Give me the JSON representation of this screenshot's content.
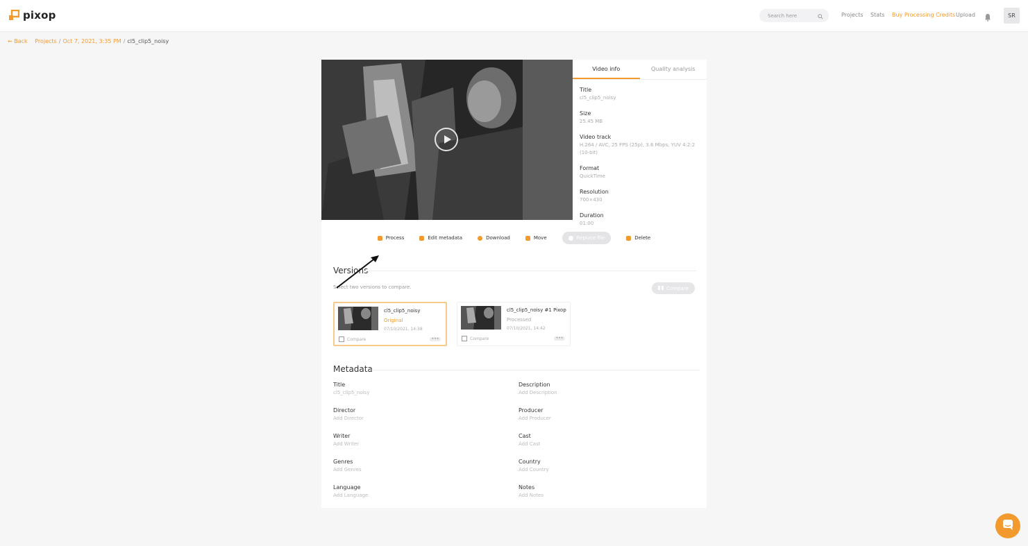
{
  "header": {
    "logo_text": "pixop",
    "search_placeholder": "Search here",
    "nav": [
      "Projects",
      "Stats",
      "Buy Processing Credits",
      "Upload"
    ],
    "avatar_initials": "SR",
    "accent_color": "#f29a2e"
  },
  "breadcrumb": {
    "back": "← Back",
    "projects": "Projects",
    "date": "Oct 7, 2021, 3:35 PM",
    "current": "cl5_clip5_noisy"
  },
  "tabs": [
    "Video info",
    "Quality analysis"
  ],
  "video_info": [
    {
      "label": "Title",
      "value": "cl5_clip5_noisy"
    },
    {
      "label": "Size",
      "value": "25.45 MB"
    },
    {
      "label": "Video track",
      "value": "H.264 / AVC, 25 FPS (25p), 3.6 Mbps, YUV 4:2:2 (10-bit)"
    },
    {
      "label": "Format",
      "value": "QuickTime"
    },
    {
      "label": "Resolution",
      "value": "700×430"
    },
    {
      "label": "Duration",
      "value": "01:00"
    }
  ],
  "actions": {
    "process": "Process",
    "edit_metadata": "Edit metadata",
    "download": "Download",
    "move": "Move",
    "replace": "Replace file",
    "delete": "Delete"
  },
  "versions": {
    "title": "Versions",
    "hint": "Select two versions to compare.",
    "compare_button": "Compare",
    "items": [
      {
        "title": "cl5_clip5_noisy",
        "status": "Original",
        "date": "07/10/2021, 14:38",
        "compare": "Compare"
      },
      {
        "title": "cl5_clip5_noisy #1 Pixop",
        "status": "Processed",
        "date": "07/10/2021, 14:42",
        "compare": "Compare"
      }
    ]
  },
  "metadata": {
    "title": "Metadata",
    "left": [
      {
        "label": "Title",
        "value": "cl5_clip5_noisy"
      },
      {
        "label": "Director",
        "value": "Add Director"
      },
      {
        "label": "Writer",
        "value": "Add Writer"
      },
      {
        "label": "Genres",
        "value": "Add Genres"
      },
      {
        "label": "Language",
        "value": "Add Language"
      }
    ],
    "right": [
      {
        "label": "Description",
        "value": "Add Description"
      },
      {
        "label": "Producer",
        "value": "Add Producer"
      },
      {
        "label": "Cast",
        "value": "Add Cast"
      },
      {
        "label": "Country",
        "value": "Add Country"
      },
      {
        "label": "Notes",
        "value": "Add Notes"
      }
    ]
  }
}
